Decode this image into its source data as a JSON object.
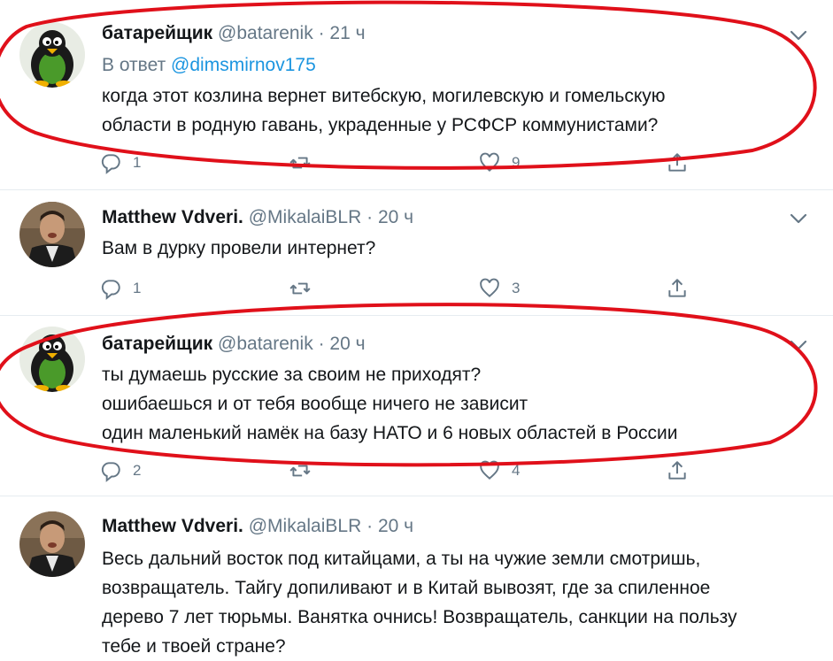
{
  "tweets": [
    {
      "name": "батарейщик",
      "handle": "@batarenik",
      "dot": "·",
      "time": "21 ч",
      "reply_prefix": "В ответ",
      "reply_mention": "@dimsmirnov175",
      "lines": [
        "когда этот козлина вернет витебскую, могилевскую и гомельскую",
        "области в родную гавань, украденные  у РСФСР коммунистами?"
      ],
      "replies": "1",
      "retweets": "",
      "likes": "9"
    },
    {
      "name": "Matthew Vdveri.",
      "handle": "@MikalaiBLR",
      "dot": "·",
      "time": "20 ч",
      "lines": [
        "Вам в дурку провели интернет?"
      ],
      "replies": "1",
      "retweets": "",
      "likes": "3"
    },
    {
      "name": "батарейщик",
      "handle": "@batarenik",
      "dot": "·",
      "time": "20 ч",
      "lines": [
        "ты думаешь русские за своим не приходят?",
        "ошибаешься и от тебя вообще ничего не зависит",
        "один маленький  намёк на базу НАТО и 6 новых областей в России"
      ],
      "replies": "2",
      "retweets": "",
      "likes": "4"
    },
    {
      "name": "Matthew Vdveri.",
      "handle": "@MikalaiBLR",
      "dot": "·",
      "time": "20 ч",
      "lines": [
        "Весь дальний восток под китайцами, а ты на чужие земли смотришь,",
        "возвращатель.  Тайгу допиливают и в Китай вывозят, где за спиленное",
        "дерево 7 лет тюрьмы. Ванятка очнись! Возвращатель, санкции на пользу",
        "тебе и твоей стране?"
      ]
    }
  ],
  "colors": {
    "muted": "#657786",
    "link": "#1b95e0",
    "annotation": "#e0101a"
  }
}
